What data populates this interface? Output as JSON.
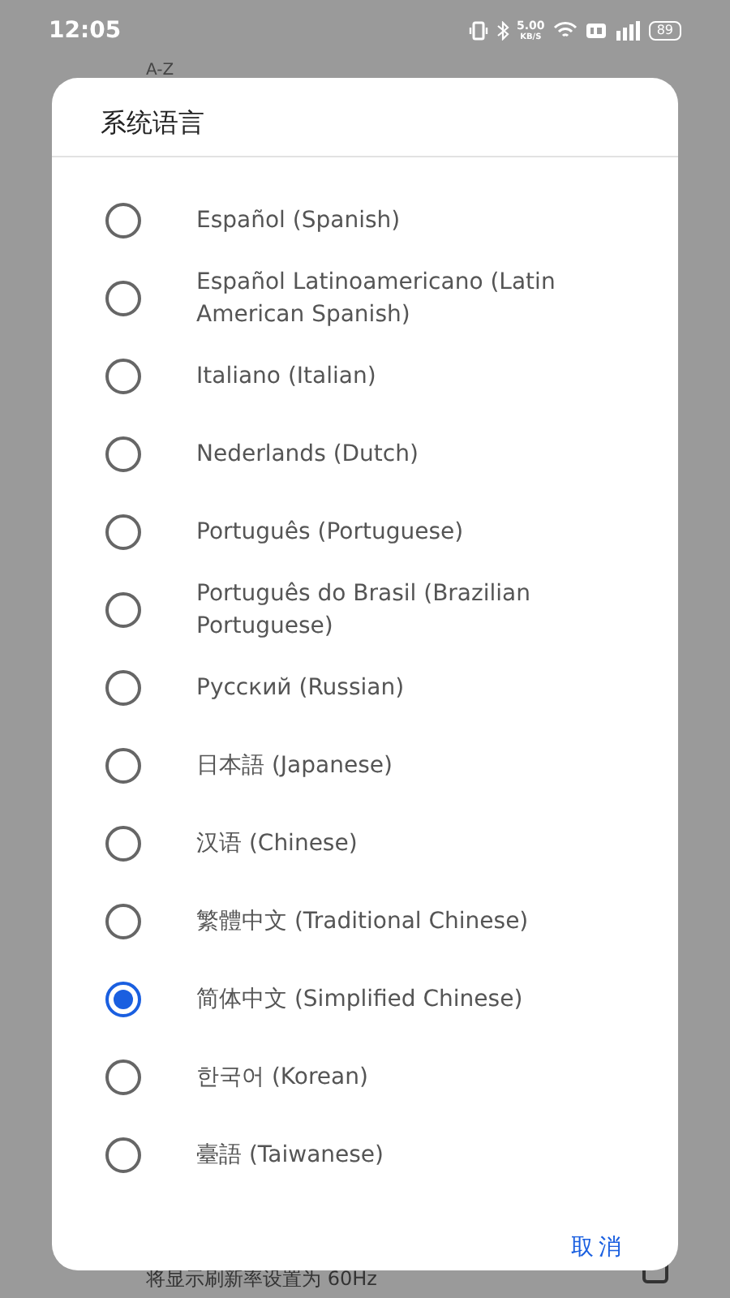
{
  "status_bar": {
    "time": "12:05",
    "speed": "5.00",
    "speed_unit": "KB/S",
    "battery": "89"
  },
  "background": {
    "sort_label": "A-Z",
    "setting_text": "将显示刷新率设置为 60Hz"
  },
  "dialog": {
    "title": "系统语言",
    "options": [
      {
        "label": "Español (Spanish)",
        "selected": false
      },
      {
        "label": "Español Latinoamericano (Latin American Spanish)",
        "selected": false
      },
      {
        "label": "Italiano (Italian)",
        "selected": false
      },
      {
        "label": "Nederlands (Dutch)",
        "selected": false
      },
      {
        "label": "Português (Portuguese)",
        "selected": false
      },
      {
        "label": "Português do Brasil (Brazilian Portuguese)",
        "selected": false
      },
      {
        "label": "Русский (Russian)",
        "selected": false
      },
      {
        "label": "日本語 (Japanese)",
        "selected": false
      },
      {
        "label": "汉语 (Chinese)",
        "selected": false
      },
      {
        "label": "繁體中文 (Traditional Chinese)",
        "selected": false
      },
      {
        "label": "简体中文 (Simplified Chinese)",
        "selected": true
      },
      {
        "label": "한국어 (Korean)",
        "selected": false
      },
      {
        "label": "臺語 (Taiwanese)",
        "selected": false
      }
    ],
    "cancel_button": "取消"
  }
}
